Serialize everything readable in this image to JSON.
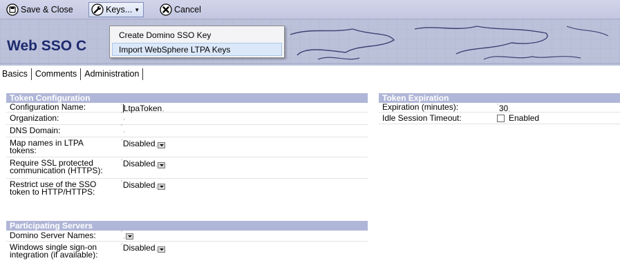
{
  "toolbar": {
    "save_close": "Save & Close",
    "keys": "Keys...",
    "cancel": "Cancel"
  },
  "banner": {
    "title": "Web SSO C"
  },
  "keys_menu": {
    "items": [
      "Create Domino SSO Key",
      "Import WebSphere LTPA Keys"
    ]
  },
  "tabs": [
    "Basics",
    "Comments",
    "Administration"
  ],
  "token_configuration": {
    "header": "Token Configuration",
    "configuration_name": {
      "label": "Configuration Name:",
      "value": "LtpaToken"
    },
    "organization": {
      "label": "Organization:",
      "value": ""
    },
    "dns_domain": {
      "label": "DNS Domain:",
      "value": ""
    },
    "map_names": {
      "label1": "Map names in LTPA",
      "label2": "tokens:",
      "value": "Disabled"
    },
    "require_ssl": {
      "label1": "Require SSL protected",
      "label2": "communication (HTTPS):",
      "value": "Disabled"
    },
    "restrict_use": {
      "label1": "Restrict use of the SSO",
      "label2": "token to HTTP/HTTPS:",
      "value": "Disabled"
    }
  },
  "participating_servers": {
    "header": "Participating Servers",
    "domino_server_names": {
      "label": "Domino Server Names:",
      "value": ""
    },
    "windows_sso": {
      "label1": "Windows single sign-on",
      "label2": "integration (if available):",
      "value": "Disabled"
    }
  },
  "token_expiration": {
    "header": "Token Expiration",
    "expiration": {
      "label": "Expiration (minutes):",
      "value": "30"
    },
    "idle_timeout": {
      "label": "Idle Session Timeout:",
      "checkbox_label": "Enabled",
      "checked": false
    }
  },
  "colors": {
    "toolbar": "#c6cae2",
    "section_header": "#b0b6d7",
    "banner_title": "#1d2a6e",
    "menu_highlight": "#dbe8f9"
  }
}
